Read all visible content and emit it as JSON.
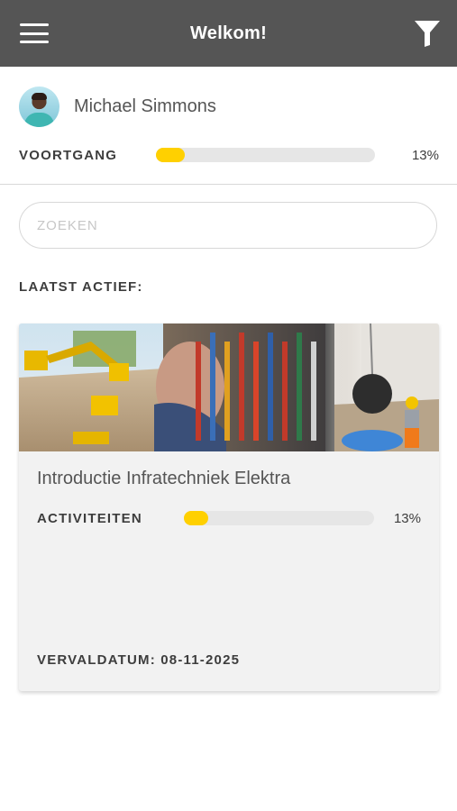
{
  "header": {
    "title": "Welkom!"
  },
  "user": {
    "name": "Michael Simmons"
  },
  "overall_progress": {
    "label": "VOORTGANG",
    "percent_text": "13%",
    "fraction": 0.13
  },
  "search": {
    "placeholder": "ZOEKEN",
    "value": ""
  },
  "recent": {
    "label": "LAATST ACTIEF:",
    "courses": [
      {
        "title": "Introductie Infratechniek Elektra",
        "progress_label": "ACTIVITEITEN",
        "percent_text": "13%",
        "fraction": 0.13,
        "due_text": "VERVALDATUM: 08-11-2025"
      }
    ]
  },
  "colors": {
    "header_bg": "#555555",
    "accent_yellow": "#ffd000",
    "track": "#e6e6e6",
    "card_bg": "#f2f2f2"
  },
  "icons": {
    "menu": "hamburger-menu-icon",
    "filter": "filter-funnel-icon"
  }
}
